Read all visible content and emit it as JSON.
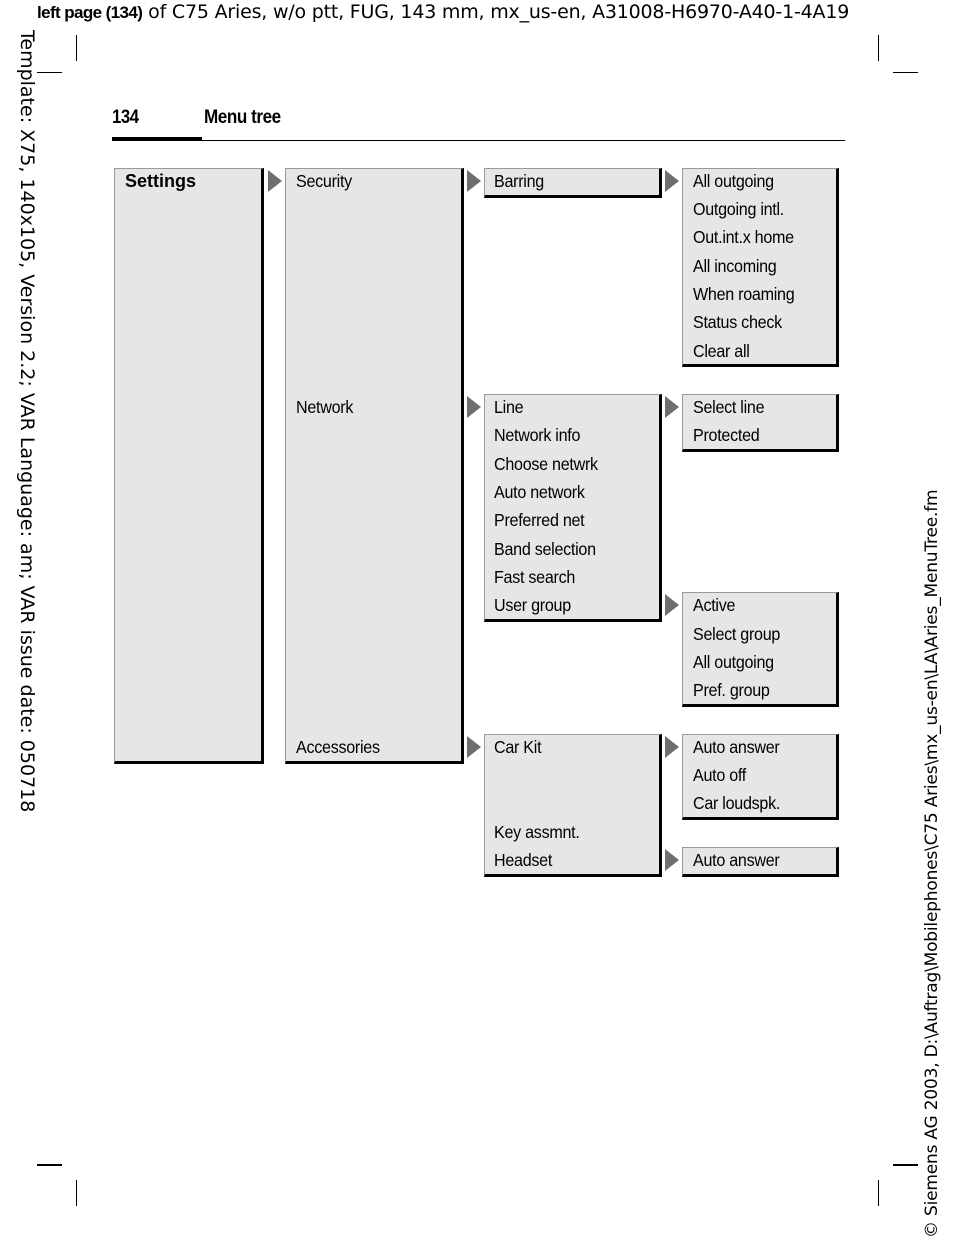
{
  "header_note": {
    "bold": "left page (134)",
    "rest": " of C75 Aries, w/o ptt, FUG, 143 mm, mx_us-en, A31008-H6970-A40-1-4A19"
  },
  "side_left": "Template: X75, 140x105, Version 2.2; VAR Language: am; VAR issue date: 050718",
  "side_right": "© Siemens AG 2003, D:\\Auftrag\\Mobilephones\\C75 Aries\\mx_us-en\\LA\\Aries_MenuTree.fm",
  "page": {
    "number": "134",
    "title": "Menu tree"
  },
  "menu_tree": {
    "root": "Settings",
    "level1": [
      "Security",
      "Network",
      "Accessories"
    ],
    "security": {
      "children": [
        "Barring"
      ],
      "barring": [
        "All outgoing",
        "Outgoing intl.",
        "Out.int.x home",
        "All incoming",
        "When roaming",
        "Status check",
        "Clear all"
      ]
    },
    "network": {
      "children": [
        "Line",
        "Network info",
        "Choose netwrk",
        "Auto network",
        "Preferred net",
        "Band selection",
        "Fast search",
        "User group"
      ],
      "line": [
        "Select line",
        "Protected"
      ],
      "user_group": [
        "Active",
        "Select group",
        "All outgoing",
        "Pref. group"
      ]
    },
    "accessories": {
      "children": [
        "Car Kit",
        "Key assmnt.",
        "Headset"
      ],
      "car_kit": [
        "Auto answer",
        "Auto off",
        "Car loudspk."
      ],
      "headset": [
        "Auto answer"
      ]
    }
  },
  "icons": {
    "submenu_arrow": "triangle-right"
  },
  "colors": {
    "box_fill": "#e6e6e6",
    "arrow": "#6e6e6e",
    "shadow": "#000000"
  }
}
